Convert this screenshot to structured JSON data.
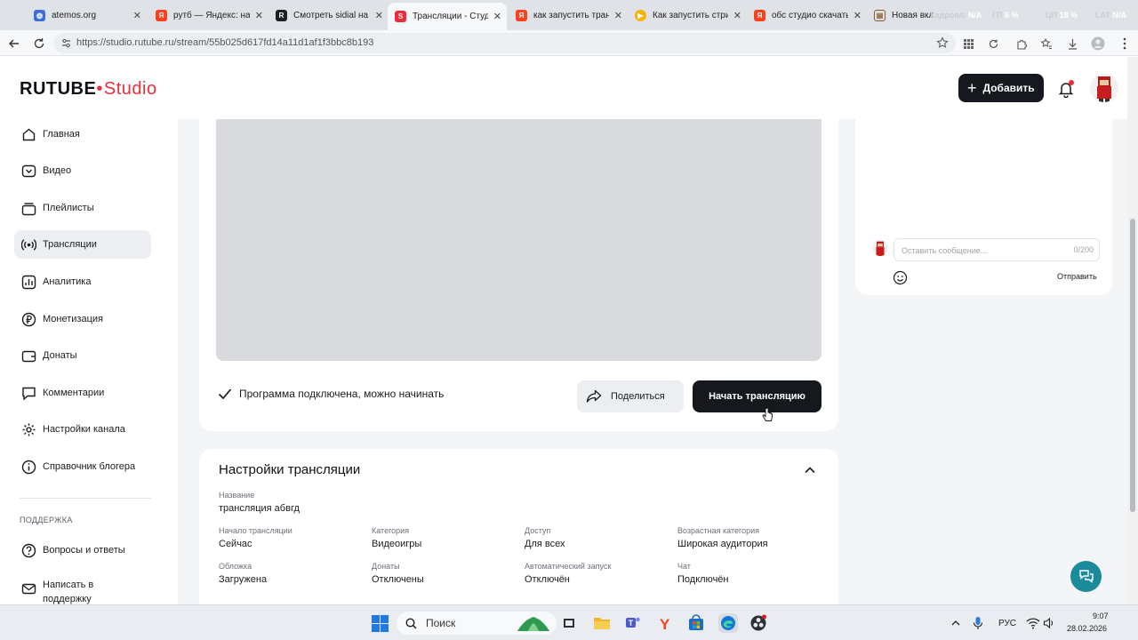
{
  "browser": {
    "tabs": [
      {
        "title": "atemos.org",
        "favicon": "globe-icon"
      },
      {
        "title": "рутб — Яндекс: нашл",
        "favicon": "yandex-icon"
      },
      {
        "title": "Смотреть sidial на R",
        "favicon": "rutube-icon"
      },
      {
        "title": "Трансляции - Студи",
        "favicon": "rutube-studio-icon"
      },
      {
        "title": "как запустить транс",
        "favicon": "yandex-icon"
      },
      {
        "title": "Как запустить стрим",
        "favicon": "youtube-icon"
      },
      {
        "title": "обс студио скачать",
        "favicon": "yandex-icon"
      },
      {
        "title": "Новая вкл",
        "favicon": "new-tab-icon"
      }
    ],
    "overlay": {
      "fps_label": "Кадров/с",
      "fps_value": "N/A",
      "gpu_label": "ГП",
      "gpu_value": "6 %",
      "cpu_label": "ЦП",
      "cpu_value": "18 %",
      "lat_label": "LAT",
      "lat_value": "N/A"
    },
    "url": "https://studio.rutube.ru/stream/55b025d617fd14a11d1af1f3bbc8b193"
  },
  "header": {
    "logo_main": "RUTUBE",
    "logo_sub": "Studio",
    "add_button": "Добавить"
  },
  "sidebar": {
    "items": [
      {
        "label": "Главная",
        "icon": "home-icon"
      },
      {
        "label": "Видео",
        "icon": "video-icon"
      },
      {
        "label": "Плейлисты",
        "icon": "playlist-icon"
      },
      {
        "label": "Трансляции",
        "icon": "broadcast-icon",
        "active": true
      },
      {
        "label": "Аналитика",
        "icon": "analytics-icon"
      },
      {
        "label": "Монетизация",
        "icon": "ruble-icon"
      },
      {
        "label": "Донаты",
        "icon": "wallet-icon"
      },
      {
        "label": "Комментарии",
        "icon": "comment-icon"
      },
      {
        "label": "Настройки канала",
        "icon": "gear-icon"
      },
      {
        "label": "Справочник блогера",
        "icon": "info-icon"
      }
    ],
    "support_heading": "ПОДДЕРЖКА",
    "support_items": [
      {
        "label": "Вопросы и ответы",
        "icon": "question-icon"
      },
      {
        "label": "Написать в поддержку",
        "icon": "mail-icon"
      }
    ]
  },
  "player": {
    "status_text": "Программа подключена, можно начинать",
    "share_button": "Поделиться",
    "start_button": "Начать трансляцию"
  },
  "settings": {
    "title": "Настройки трансляции",
    "name_label": "Название",
    "name_value": "трансляция абвгд",
    "fields": [
      {
        "label": "Начало трансляции",
        "value": "Сейчас"
      },
      {
        "label": "Категория",
        "value": "Видеоигры"
      },
      {
        "label": "Доступ",
        "value": "Для всех"
      },
      {
        "label": "Возрастная категория",
        "value": "Широкая аудитория"
      },
      {
        "label": "Обложка",
        "value": "Загружена"
      },
      {
        "label": "Донаты",
        "value": "Отключены"
      },
      {
        "label": "Автоматический запуск",
        "value": "Отключён"
      },
      {
        "label": "Чат",
        "value": "Подключён"
      }
    ]
  },
  "chat": {
    "placeholder": "Оставить сообщение...",
    "counter": "0/200",
    "send_button": "Отправить"
  },
  "taskbar": {
    "search_label": "Поиск",
    "language": "РУС",
    "time": "9:07",
    "date": "28.02.2026"
  },
  "colors": {
    "brand_red": "#ef2c3b",
    "dark_button": "#15181d",
    "help_teal": "#1b8a9a"
  }
}
